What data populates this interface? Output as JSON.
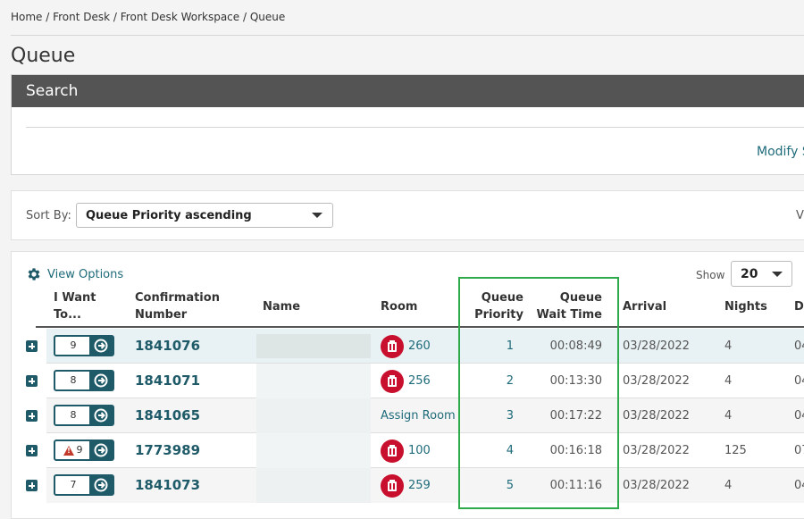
{
  "breadcrumb": "Home / Front Desk / Front Desk Workspace / Queue",
  "page_title": "Queue",
  "search": {
    "title": "Search",
    "modify_link": "Modify S"
  },
  "sort": {
    "label": "Sort By:",
    "value": "Queue Priority ascending",
    "right_label": "V"
  },
  "view_options": "View Options",
  "show": {
    "label": "Show",
    "value": "20"
  },
  "columns": {
    "iwant": [
      "I Want",
      "To..."
    ],
    "confirmation": [
      "Confirmation",
      "Number"
    ],
    "name": "Name",
    "room": "Room",
    "queue_priority": [
      "Queue",
      "Priority"
    ],
    "queue_wait": [
      "Queue",
      "Wait Time"
    ],
    "arrival": "Arrival",
    "nights": "Nights",
    "departure": "D"
  },
  "rows": [
    {
      "iwant": "9",
      "warning": false,
      "confirmation": "1841076",
      "room": "260",
      "room_icon": true,
      "priority": "1",
      "wait": "00:08:49",
      "arrival": "03/28/2022",
      "nights": "4",
      "departure": "04"
    },
    {
      "iwant": "8",
      "warning": false,
      "confirmation": "1841071",
      "room": "256",
      "room_icon": true,
      "priority": "2",
      "wait": "00:13:30",
      "arrival": "03/28/2022",
      "nights": "4",
      "departure": "04"
    },
    {
      "iwant": "8",
      "warning": false,
      "confirmation": "1841065",
      "room": "Assign Room",
      "room_icon": false,
      "priority": "3",
      "wait": "00:17:22",
      "arrival": "03/28/2022",
      "nights": "4",
      "departure": "04"
    },
    {
      "iwant": "9",
      "warning": true,
      "confirmation": "1773989",
      "room": "100",
      "room_icon": true,
      "priority": "4",
      "wait": "00:16:18",
      "arrival": "03/28/2022",
      "nights": "125",
      "departure": "07"
    },
    {
      "iwant": "7",
      "warning": false,
      "confirmation": "1841073",
      "room": "259",
      "room_icon": true,
      "priority": "5",
      "wait": "00:11:16",
      "arrival": "03/28/2022",
      "nights": "4",
      "departure": "04"
    }
  ],
  "icons": {
    "expand": "plus-square-icon",
    "action": "arrow-circle-right-icon",
    "room": "room-status-icon",
    "warning": "warning-triangle-icon",
    "settings": "gear-icon"
  },
  "colors": {
    "accent": "#1e6b7a",
    "header_bar": "#545454",
    "room_icon": "#c8102e",
    "highlight_box": "#2eaa4a",
    "selected_row": "#e8f1f3",
    "alt_row": "#f5f5f5"
  }
}
